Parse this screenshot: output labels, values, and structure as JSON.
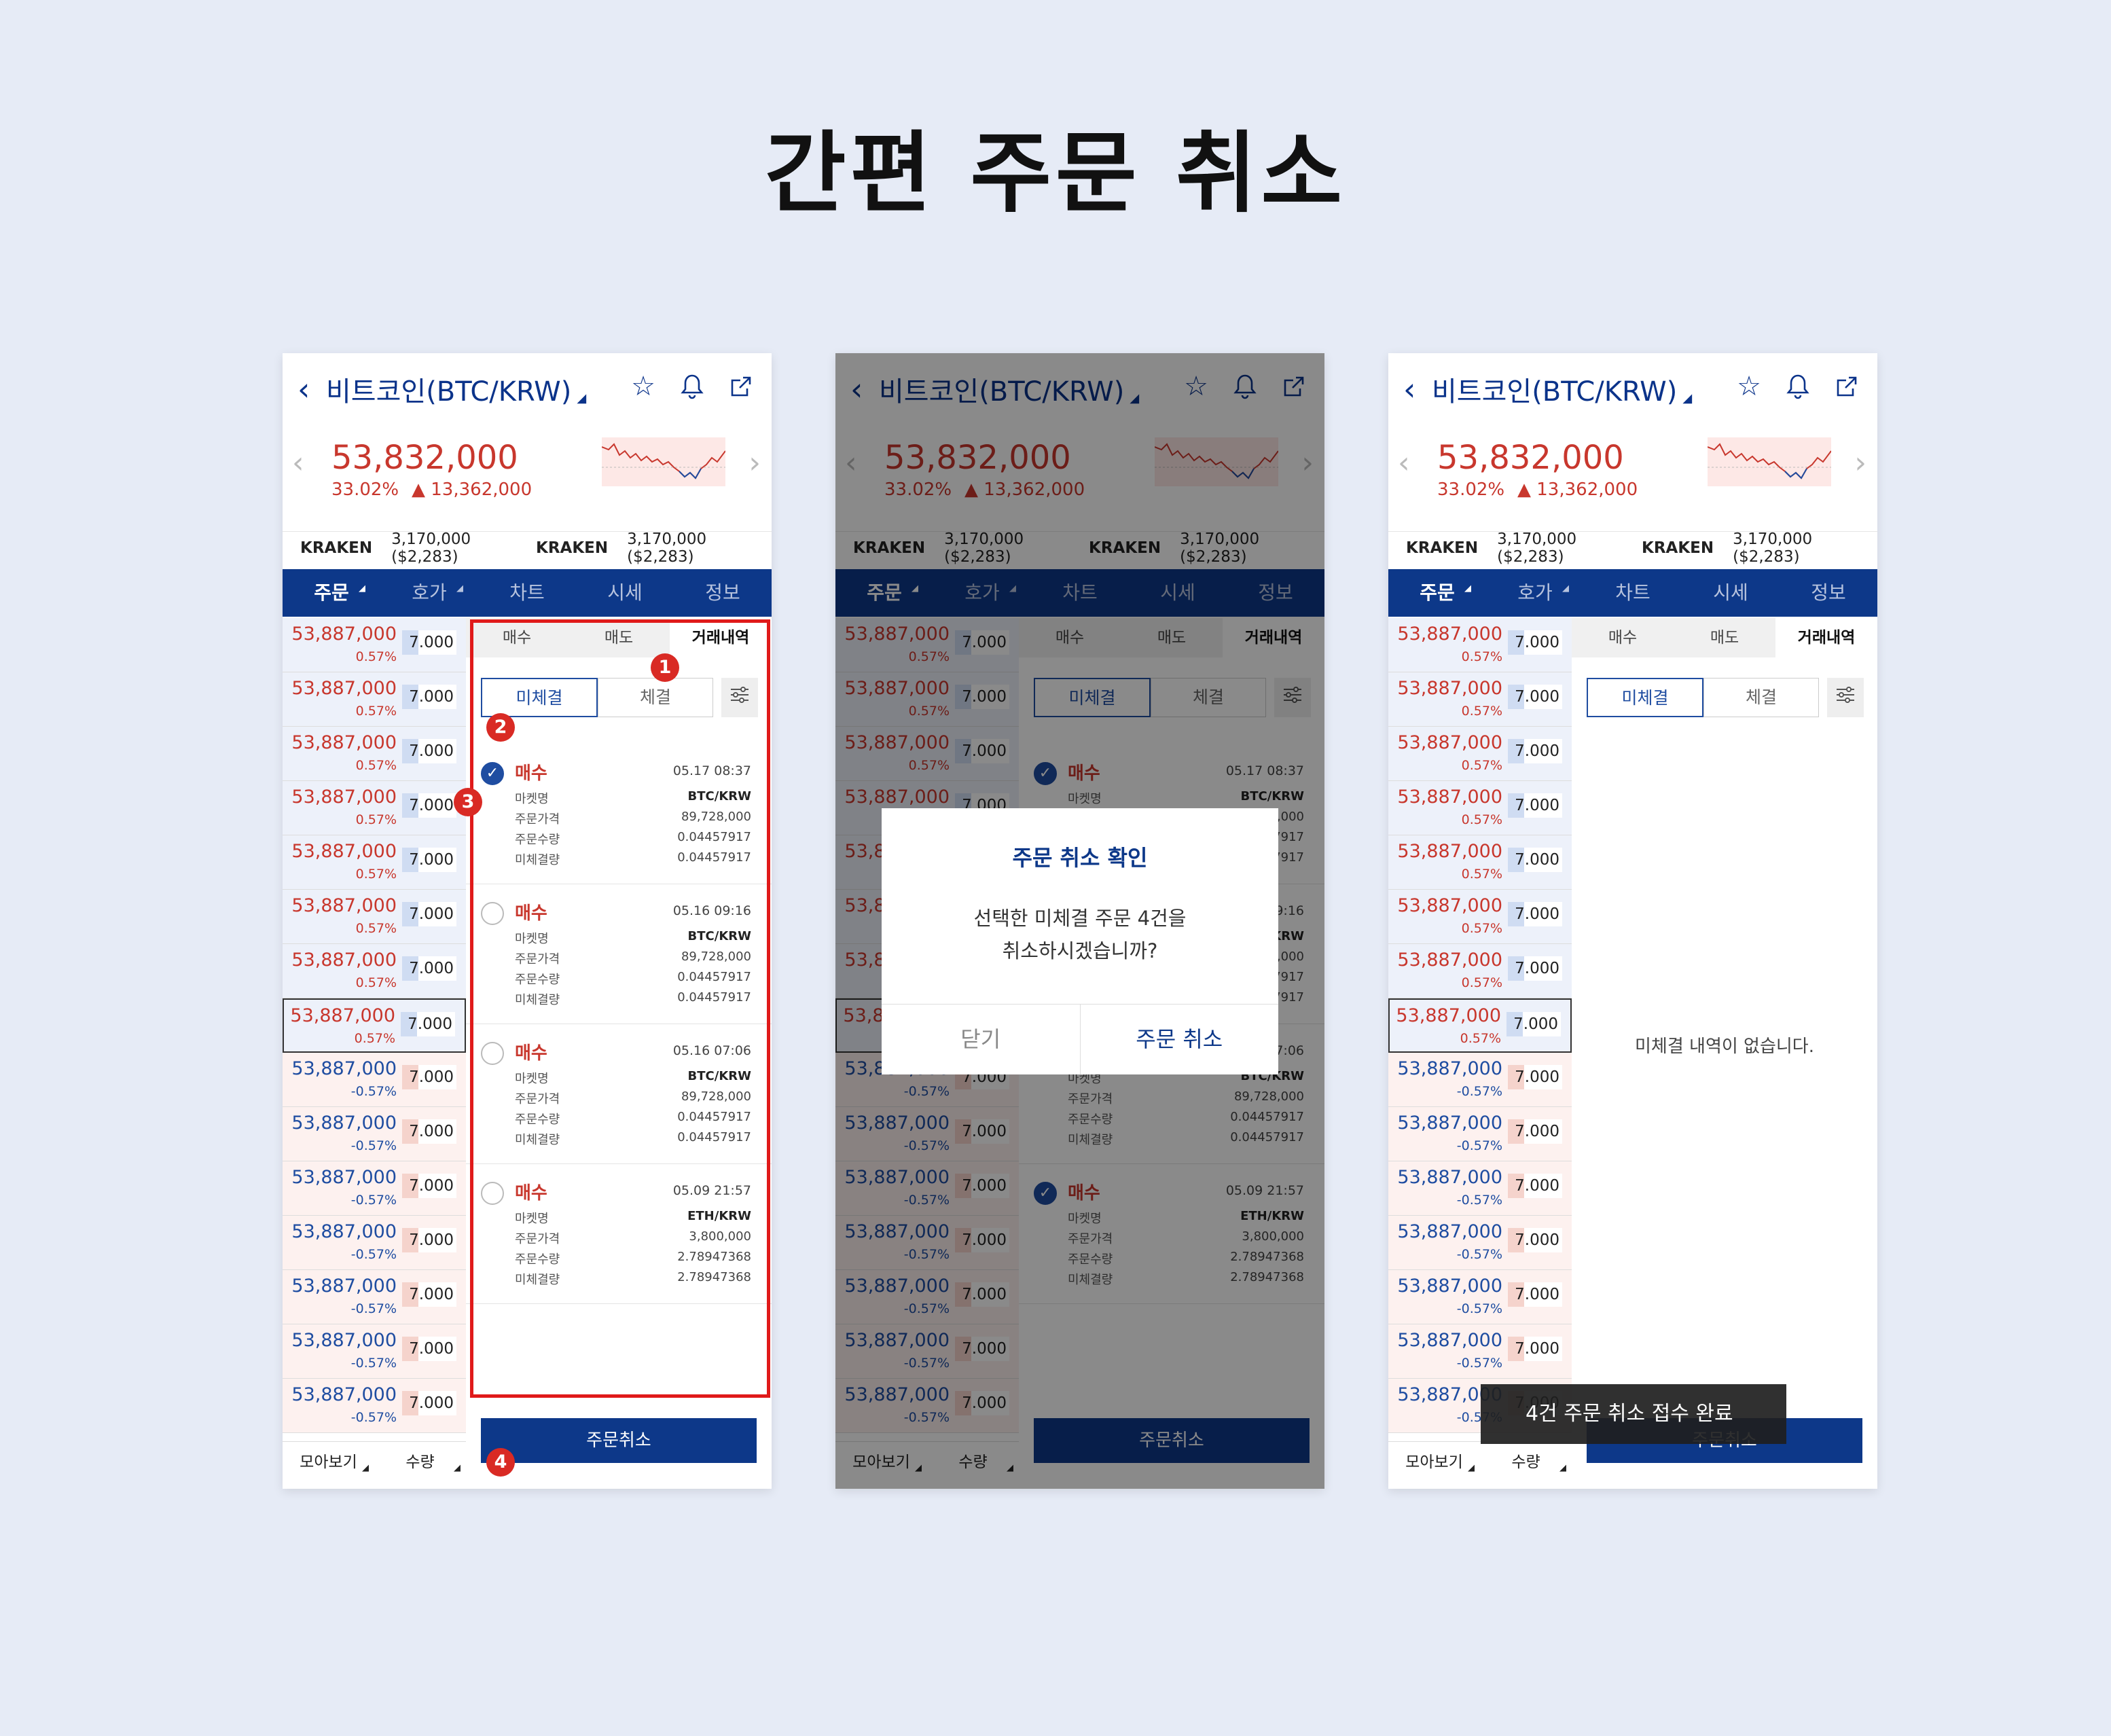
{
  "page_title": "간편 주문 취소",
  "coin_name": "비트코인(BTC/KRW)",
  "price": "53,832,000",
  "change_rate": "33.02%",
  "change_amount": "▲ 13,362,000",
  "exchange": [
    {
      "name": "KRAKEN",
      "value": "3,170,000 ($2,283)"
    },
    {
      "name": "KRAKEN",
      "value": "3,170,000 ($2,283)"
    }
  ],
  "main_tabs": [
    "주문",
    "호가",
    "차트",
    "시세",
    "정보"
  ],
  "orderbook": {
    "price": "53,887,000",
    "up_change": "0.57%",
    "down_change": "-0.57%",
    "volume": "7.000"
  },
  "orderbook_footer": [
    "모아보기",
    "수량"
  ],
  "sub_tabs": [
    "매수",
    "매도",
    "거래내역"
  ],
  "segment": [
    "미체결",
    "체결"
  ],
  "order_labels": [
    "마켓명",
    "주문가격",
    "주문수량",
    "미체결량"
  ],
  "orders": [
    {
      "side": "매수",
      "date": "05.17 08:37",
      "market": "BTC/KRW",
      "price": "89,728,000",
      "qty": "0.04457917",
      "remain": "0.04457917"
    },
    {
      "side": "매수",
      "date": "05.16 09:16",
      "market": "BTC/KRW",
      "price": "89,728,000",
      "qty": "0.04457917",
      "remain": "0.04457917"
    },
    {
      "side": "매수",
      "date": "05.16 07:06",
      "market": "BTC/KRW",
      "price": "89,728,000",
      "qty": "0.04457917",
      "remain": "0.04457917"
    },
    {
      "side": "매수",
      "date": "05.09 21:57",
      "market": "ETH/KRW",
      "price": "3,800,000",
      "qty": "2.78947368",
      "remain": "2.78947368"
    }
  ],
  "cancel_button": "주문취소",
  "badges": [
    "1",
    "2",
    "3",
    "4"
  ],
  "dialog": {
    "title": "주문 취소 확인",
    "message_line1": "선택한 미체결 주문 4건을",
    "message_line2": "취소하시겠습니까?",
    "close": "닫기",
    "confirm": "주문 취소"
  },
  "empty_message": "미체결 내역이 없습니다.",
  "toast": "4건 주문 취소 접수 완료",
  "colors": {
    "brand": "#0d3889",
    "up": "#c8372d",
    "down": "#1f4da1",
    "marker": "#d92a24"
  }
}
